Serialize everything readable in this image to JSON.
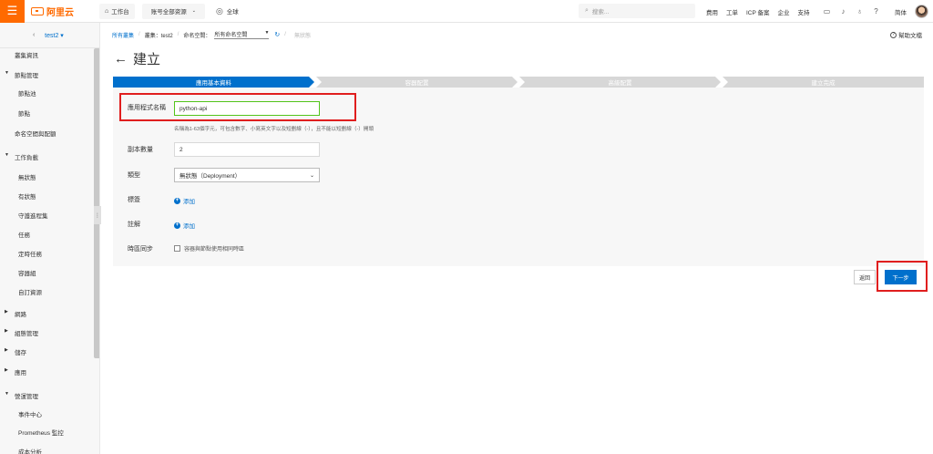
{
  "topbar": {
    "logo_text": "阿里云",
    "workbench": "工作台",
    "resource_scope": "账号全部资源",
    "region": "全球",
    "search_placeholder": "搜索...",
    "links": [
      "费用",
      "工单",
      "ICP 备案",
      "企业",
      "支持"
    ],
    "lang": "简体",
    "icons": [
      "mail-icon",
      "bell-icon",
      "location-icon",
      "help-icon"
    ]
  },
  "sidebar": {
    "cluster": "test2",
    "items": [
      {
        "label": "叢集資訊",
        "type": "item"
      },
      {
        "label": "節點管理",
        "type": "group"
      },
      {
        "label": "節點池",
        "type": "sub"
      },
      {
        "label": "節點",
        "type": "sub"
      },
      {
        "label": "命名空間與配額",
        "type": "item"
      },
      {
        "label": "工作負載",
        "type": "group"
      },
      {
        "label": "無狀態",
        "type": "sub"
      },
      {
        "label": "有狀態",
        "type": "sub"
      },
      {
        "label": "守護進程集",
        "type": "sub"
      },
      {
        "label": "任務",
        "type": "sub"
      },
      {
        "label": "定時任務",
        "type": "sub"
      },
      {
        "label": "容器組",
        "type": "sub"
      },
      {
        "label": "自訂資源",
        "type": "sub"
      },
      {
        "label": "網路",
        "type": "group"
      },
      {
        "label": "組態管理",
        "type": "group"
      },
      {
        "label": "儲存",
        "type": "group"
      },
      {
        "label": "應用",
        "type": "group"
      },
      {
        "label": "營運管理",
        "type": "group"
      },
      {
        "label": "事件中心",
        "type": "sub"
      },
      {
        "label": "Prometheus 監控",
        "type": "sub"
      },
      {
        "label": "成本分析",
        "type": "sub"
      }
    ]
  },
  "breadcrumb": {
    "all_clusters": "所有叢集",
    "cluster": "叢集：test2",
    "namespace_label": "命名空間：",
    "namespace_value": "所有命名空間",
    "status": "無狀態"
  },
  "help_doc": "幫助文檔",
  "page_title": "建立",
  "steps": [
    "應用基本資料",
    "容器配置",
    "高級配置",
    "建立完成"
  ],
  "form": {
    "app_name_label": "應用程式名稱",
    "app_name_value": "python-api",
    "app_name_hint": "名稱為1-63個字元，可包含數字、小寫英文字以及短劃線（-），且不能以短劃線（-）開頭",
    "replicas_label": "副本數量",
    "replicas_value": "2",
    "type_label": "類型",
    "type_value": "無狀態（Deployment）",
    "tags_label": "標簽",
    "tags_add": "添加",
    "annotations_label": "註解",
    "annotations_add": "添加",
    "tz_label": "時區同步",
    "tz_checkbox_label": "容器與節點使用相同時區"
  },
  "buttons": {
    "back": "返回",
    "next": "下一步"
  }
}
